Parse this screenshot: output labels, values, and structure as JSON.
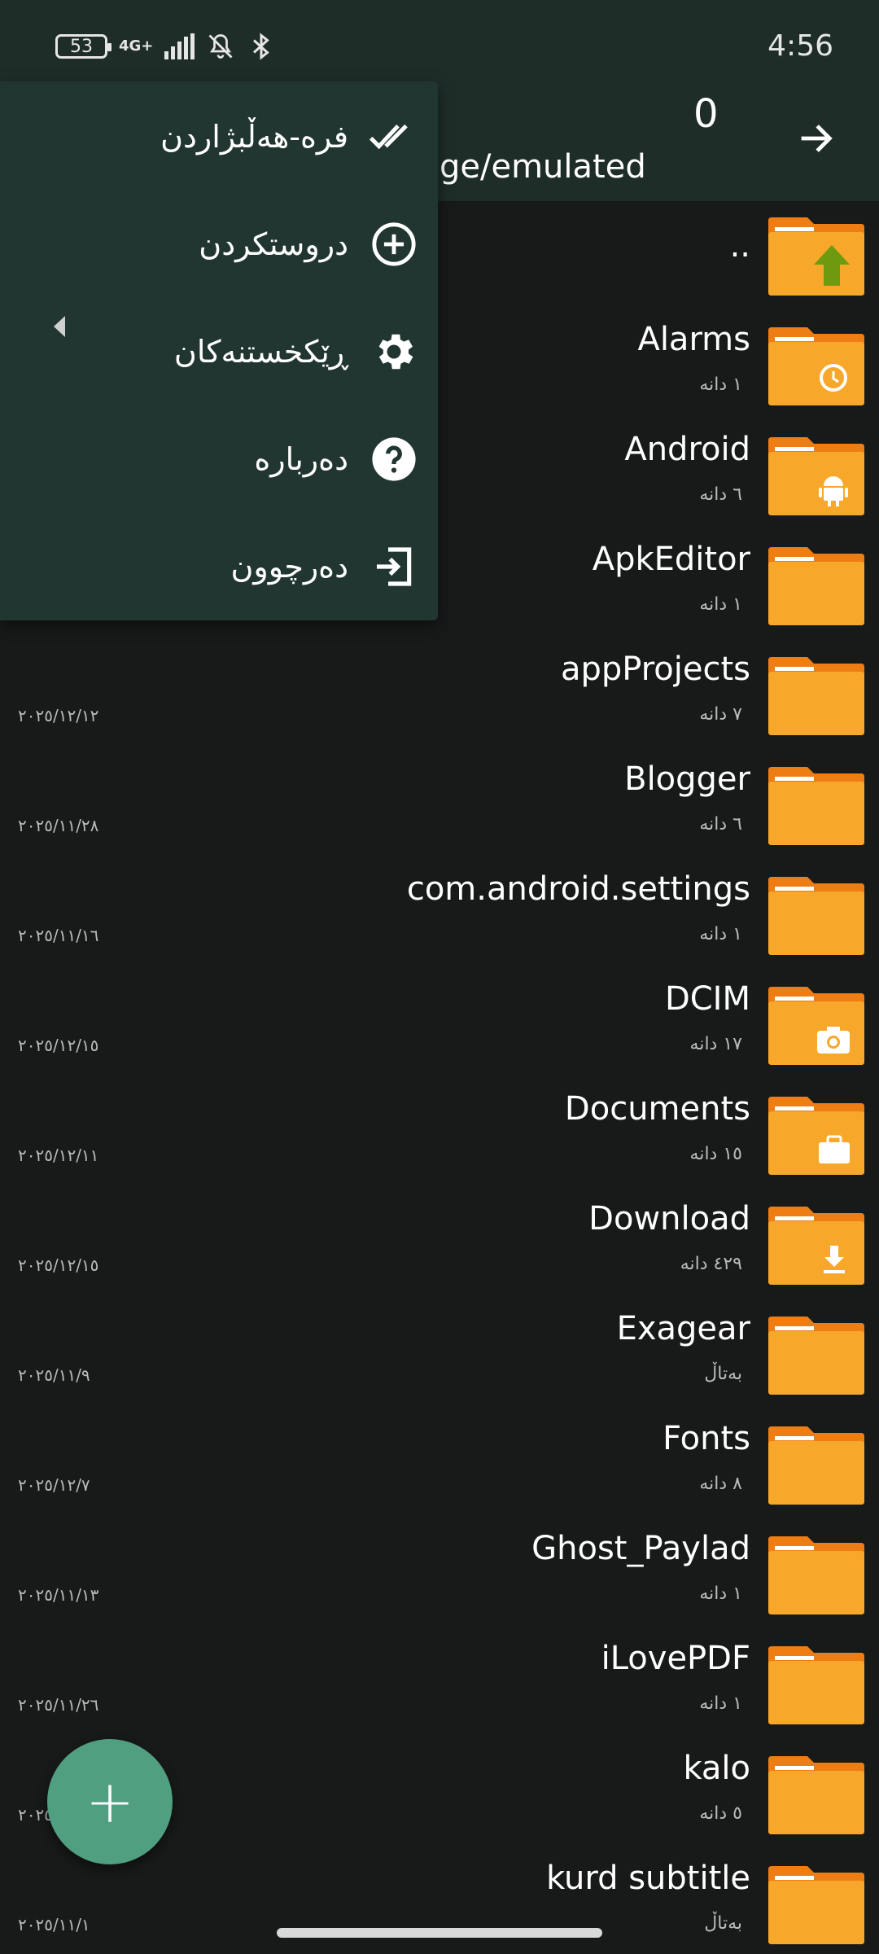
{
  "status": {
    "battery": "53",
    "network": "4G+",
    "time": "4:56"
  },
  "header": {
    "count": "0",
    "path": "ge/emulated",
    "forward_icon": "arrow-right-icon"
  },
  "menu": {
    "items": [
      {
        "label": "فره-هەڵبژاردن",
        "icon": "multi-select-icon"
      },
      {
        "label": "دروستکردن",
        "icon": "add-circle-icon"
      },
      {
        "label": "ڕێکخستنەکان",
        "icon": "gear-icon"
      },
      {
        "label": "دەربارە",
        "icon": "help-icon"
      },
      {
        "label": "دەرچوون",
        "icon": "exit-icon"
      }
    ]
  },
  "files": [
    {
      "name": "..",
      "meta": "",
      "date": "",
      "icon": "folder-up-icon"
    },
    {
      "name": "Alarms",
      "meta": "١ دانە",
      "date": "",
      "icon": "folder-alarm-icon"
    },
    {
      "name": "Android",
      "meta": "٦ دانە",
      "date": "",
      "icon": "folder-android-icon"
    },
    {
      "name": "ApkEditor",
      "meta": "١ دانە",
      "date": "",
      "icon": "folder-icon"
    },
    {
      "name": "appProjects",
      "meta": "٧ دانە",
      "date": "٢٠٢٥/١٢/١٢",
      "icon": "folder-icon"
    },
    {
      "name": "Blogger",
      "meta": "٦ دانە",
      "date": "٢٠٢٥/١١/٢٨",
      "icon": "folder-icon"
    },
    {
      "name": "com.android.settings",
      "meta": "١ دانە",
      "date": "٢٠٢٥/١١/١٦",
      "icon": "folder-icon"
    },
    {
      "name": "DCIM",
      "meta": "١٧ دانە",
      "date": "٢٠٢٥/١٢/١٥",
      "icon": "folder-camera-icon"
    },
    {
      "name": "Documents",
      "meta": "١٥ دانە",
      "date": "٢٠٢٥/١٢/١١",
      "icon": "folder-briefcase-icon"
    },
    {
      "name": "Download",
      "meta": "٤٢٩ دانە",
      "date": "٢٠٢٥/١٢/١٥",
      "icon": "folder-download-icon"
    },
    {
      "name": "Exagear",
      "meta": "بەتاڵ",
      "date": "٢٠٢٥/١١/٩",
      "icon": "folder-icon"
    },
    {
      "name": "Fonts",
      "meta": "٨ دانە",
      "date": "٢٠٢٥/١٢/٧",
      "icon": "folder-icon"
    },
    {
      "name": "Ghost_Paylad",
      "meta": "١ دانە",
      "date": "٢٠٢٥/١١/١٣",
      "icon": "folder-icon"
    },
    {
      "name": "iLovePDF",
      "meta": "١ دانە",
      "date": "٢٠٢٥/١١/٢٦",
      "icon": "folder-icon"
    },
    {
      "name": "kalo",
      "meta": "٥ دانە",
      "date": "٢٠٢٥/",
      "icon": "folder-icon"
    },
    {
      "name": "kurd subtitle",
      "meta": "بەتاڵ",
      "date": "٢٠٢٥/١١/١",
      "icon": "folder-icon"
    }
  ],
  "fab": {
    "label": "+",
    "icon": "plus-icon"
  },
  "colors": {
    "background": "#181a19",
    "header": "#1f2d28",
    "menu": "#213630",
    "folder": "#f7a82a",
    "folder_tab": "#ee7d13",
    "fab": "#4f9f80"
  }
}
